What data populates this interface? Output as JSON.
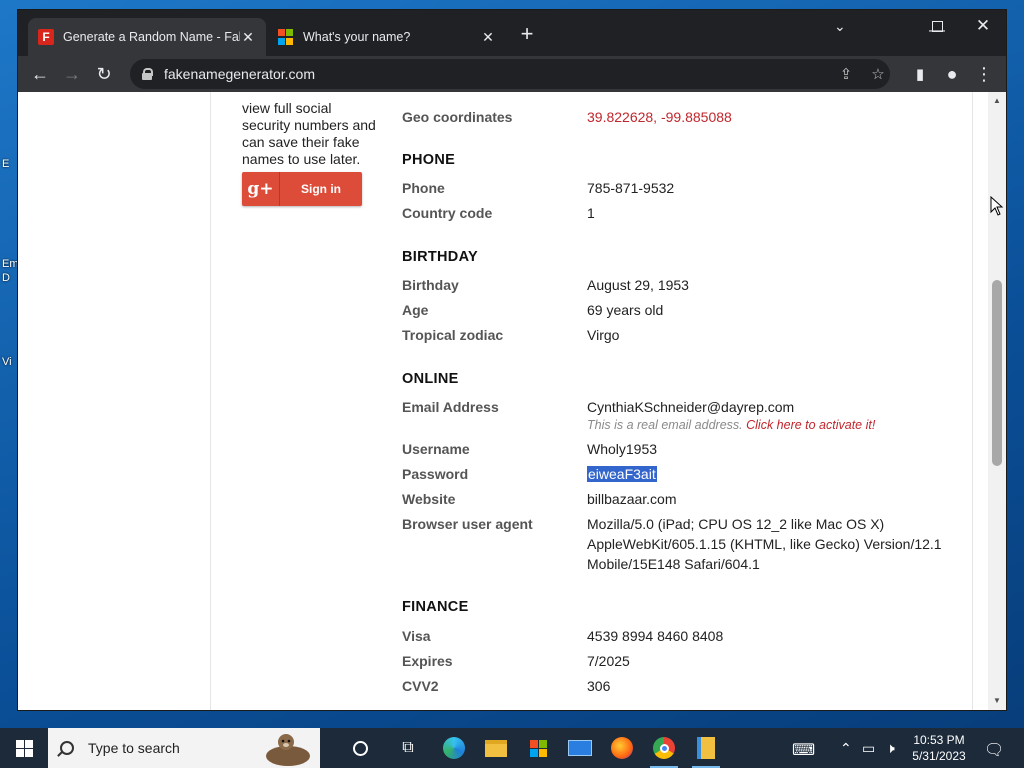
{
  "browser": {
    "tabs": [
      {
        "title": "Generate a Random Name - Fake",
        "favicon": "fakenamegenerator-favicon",
        "active": true
      },
      {
        "title": "What's your name?",
        "favicon": "microsoft-favicon",
        "active": false
      }
    ],
    "url": "fakenamegenerator.com"
  },
  "sidebar": {
    "text_lines": [
      "view full social",
      "security numbers and",
      "can save their fake",
      "names to use later."
    ],
    "gplus_icon": "g+",
    "signin_label": "Sign in"
  },
  "details": {
    "geo": {
      "label": "Geo coordinates",
      "value": "39.822628, -99.885088"
    },
    "phone_section": "PHONE",
    "phone": {
      "label": "Phone",
      "value": "785-871-9532"
    },
    "country_code": {
      "label": "Country code",
      "value": "1"
    },
    "birthday_section": "BIRTHDAY",
    "birthday": {
      "label": "Birthday",
      "value": "August 29, 1953"
    },
    "age": {
      "label": "Age",
      "value": "69 years old"
    },
    "zodiac": {
      "label": "Tropical zodiac",
      "value": "Virgo"
    },
    "online_section": "ONLINE",
    "email": {
      "label": "Email Address",
      "value": "CynthiaKSchneider@dayrep.com"
    },
    "email_note": "This is a real email address.",
    "email_link": "Click here to activate it!",
    "username": {
      "label": "Username",
      "value": "Wholy1953"
    },
    "password": {
      "label": "Password",
      "value": "eiweaF3ait"
    },
    "website": {
      "label": "Website",
      "value": "billbazaar.com"
    },
    "user_agent": {
      "label": "Browser user agent",
      "lines": [
        "Mozilla/5.0 (iPad; CPU OS 12_2 like Mac OS X)",
        "AppleWebKit/605.1.15 (KHTML, like Gecko) Version/12.1",
        "Mobile/15E148 Safari/604.1"
      ]
    },
    "finance_section": "FINANCE",
    "visa": {
      "label": "Visa",
      "value": "4539 8994 8460 8408"
    },
    "expires": {
      "label": "Expires",
      "value": "7/2025"
    },
    "cvv": {
      "label": "CVV2",
      "value": "306"
    }
  },
  "taskbar": {
    "search_placeholder": "Type to search",
    "time": "10:53 PM",
    "date": "5/31/2023"
  },
  "desktop": {
    "icon_labels": [
      "E",
      "Em",
      "D",
      "Vi"
    ]
  }
}
